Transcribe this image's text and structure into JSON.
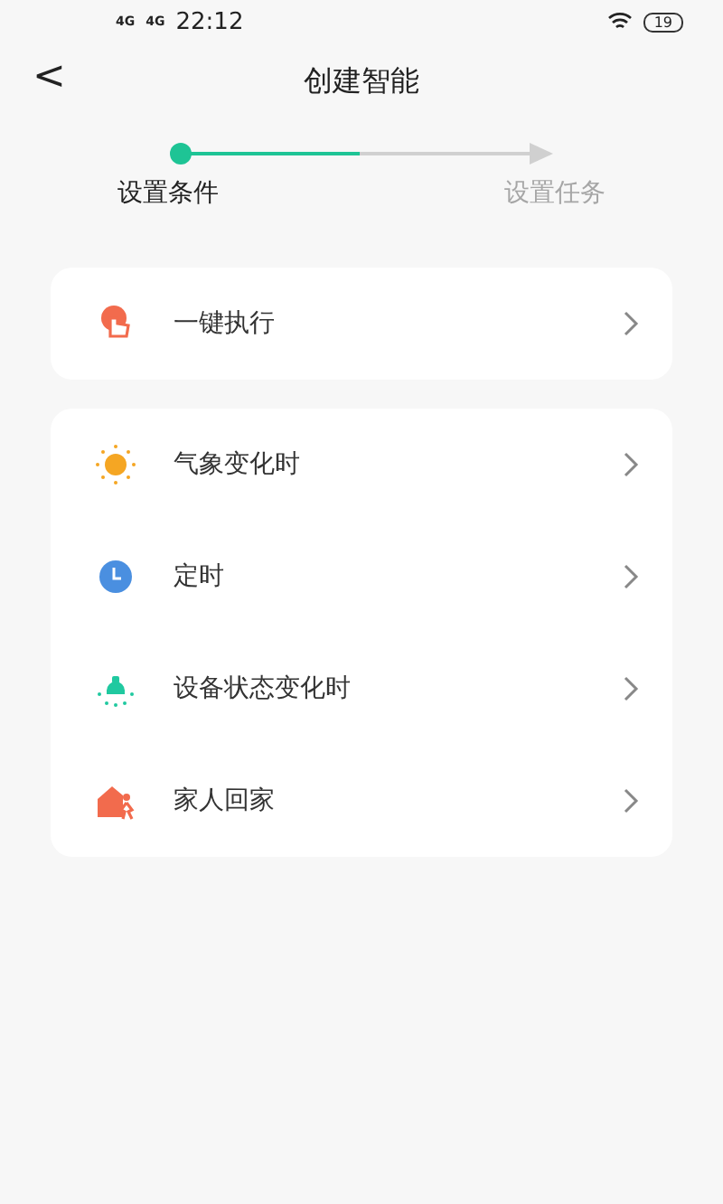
{
  "status_bar": {
    "network_1": "4G",
    "network_2": "4G",
    "time": "22:12",
    "battery": "19"
  },
  "header": {
    "back": "<",
    "title": "创建智能"
  },
  "steps": [
    {
      "label": "设置条件",
      "selected": true
    },
    {
      "label": "设置任务",
      "selected": false
    }
  ],
  "groups": [
    {
      "items": [
        {
          "kind": "tap",
          "label": "一键执行"
        }
      ]
    },
    {
      "items": [
        {
          "kind": "weather",
          "label": "气象变化时"
        },
        {
          "kind": "clock",
          "label": "定时"
        },
        {
          "kind": "device",
          "label": "设备状态变化时"
        },
        {
          "kind": "home",
          "label": "家人回家"
        }
      ]
    }
  ]
}
